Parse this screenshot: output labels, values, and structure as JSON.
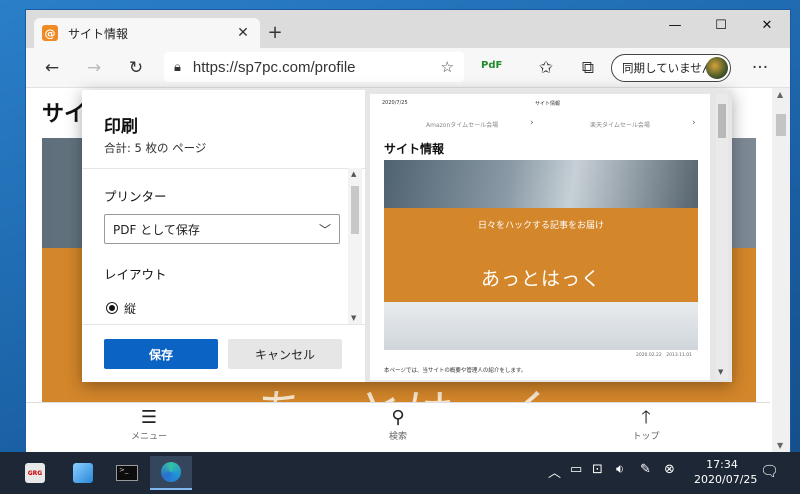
{
  "browser": {
    "tab_title": "サイト情報",
    "favicon_char": "@",
    "url": "https://sp7pc.com/profile",
    "sync_label": "同期していません",
    "more_label": "···",
    "pdf_ext_label": "PdF"
  },
  "page": {
    "title": "サイ",
    "hero_text": "あっとはっく",
    "bottom_nav": [
      {
        "icon": "menu-icon",
        "label": "メニュー"
      },
      {
        "icon": "search-icon",
        "label": "検索"
      },
      {
        "icon": "arrow-up-icon",
        "label": "トップ"
      }
    ]
  },
  "print_dialog": {
    "title": "印刷",
    "total": "合計: 5 枚の ページ",
    "printer_label": "プリンター",
    "printer_value": "PDF として保存",
    "layout_label": "レイアウト",
    "orientation_option": "縦",
    "save_label": "保存",
    "cancel_label": "キャンセル"
  },
  "preview": {
    "date": "2020/7/25",
    "site": "サイト情報",
    "nav_left": "Amazonタイムセール会場",
    "nav_right": "楽天タイムセール会場",
    "title": "サイト情報",
    "subtitle": "日々をハックする記事をお届け",
    "big_text": "あっとはっく",
    "dates": "2020.02.22　2013.11.01",
    "body": "本ページでは、当サイトの概要や管理人の紹介をします。"
  },
  "taskbar": {
    "time": "17:34",
    "date": "2020/07/25",
    "app1_label": "GRG",
    "app3_label": ">_"
  }
}
